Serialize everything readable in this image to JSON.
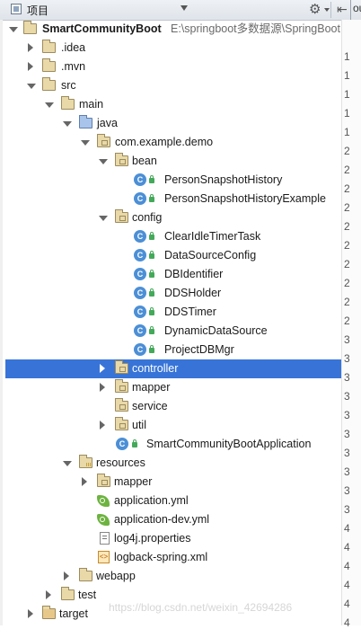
{
  "toolbar": {
    "title": "项目",
    "right_text": "ou"
  },
  "tree": {
    "root": {
      "label": "SmartCommunityBoot",
      "path": "E:\\springboot多数据源\\SpringBoot"
    },
    "idea": ".idea",
    "mvn": ".mvn",
    "src": "src",
    "main": "main",
    "java": "java",
    "pkg": "com.example.demo",
    "bean": "bean",
    "bean_items": [
      "PersonSnapshotHistory",
      "PersonSnapshotHistoryExample"
    ],
    "config": "config",
    "config_items": [
      "ClearIdleTimerTask",
      "DataSourceConfig",
      "DBIdentifier",
      "DDSHolder",
      "DDSTimer",
      "DynamicDataSource",
      "ProjectDBMgr"
    ],
    "controller": "controller",
    "mapper": "mapper",
    "service": "service",
    "util": "util",
    "app": "SmartCommunityBootApplication",
    "resources": "resources",
    "res_mapper": "mapper",
    "app_yml": "application.yml",
    "app_dev_yml": "application-dev.yml",
    "log4j": "log4j.properties",
    "logback": "logback-spring.xml",
    "webapp": "webapp",
    "test": "test",
    "target": "target"
  },
  "gutter": {
    "numbers": [
      "1",
      "1",
      "1",
      "1",
      "1",
      "2",
      "2",
      "2",
      "2",
      "2",
      "2",
      "2",
      "2",
      "2",
      "2",
      "3",
      "3",
      "3",
      "3",
      "3",
      "3",
      "3",
      "3",
      "3",
      "3",
      "4",
      "4",
      "4",
      "4",
      "4",
      "4"
    ]
  },
  "watermark": "https://blog.csdn.net/weixin_42694286",
  "colors": {
    "selection": "#3874d8",
    "class_icon": "#4c8fd6",
    "folder": "#e9d9a8",
    "source_folder": "#a9c4ea"
  }
}
